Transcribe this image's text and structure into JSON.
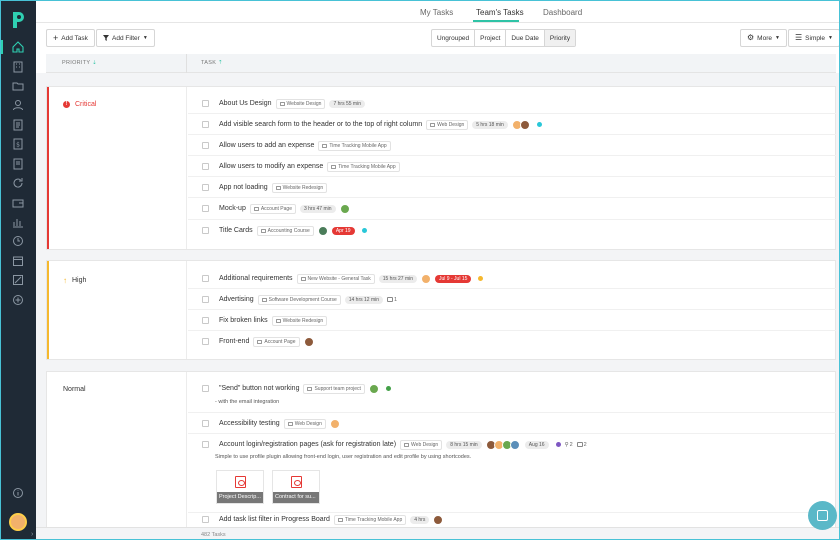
{
  "tabs": {
    "my_tasks": "My Tasks",
    "teams_tasks": "Team's Tasks",
    "dashboard": "Dashboard"
  },
  "toolbar": {
    "add_task": "Add Task",
    "add_filter": "Add Filter",
    "group_by": [
      "Ungrouped",
      "Project",
      "Due Date",
      "Priority"
    ],
    "group_by_active": "Priority",
    "more": "More",
    "view_mode": "Simple"
  },
  "columns": {
    "priority": "PRIORITY",
    "task": "TASK"
  },
  "groups": {
    "critical": {
      "label": "Critical",
      "tasks": [
        {
          "name": "About Us Design",
          "project": "Website Design",
          "time": "7 hrs 55 min"
        },
        {
          "name": "Add visible search form to the header or to the top of right column",
          "project": "Web Design",
          "time": "5 hrs 18 min"
        },
        {
          "name": "Allow users to add an expense",
          "project": "Time Tracking Mobile App"
        },
        {
          "name": "Allow users to modify an expense",
          "project": "Time Tracking Mobile App"
        },
        {
          "name": "App not loading",
          "project": "Website Redesign"
        },
        {
          "name": "Mock-up",
          "project": "Account Page",
          "time": "3 hrs 47 min"
        },
        {
          "name": "Title Cards",
          "project": "Accounting Course",
          "due": "Apr 19"
        }
      ]
    },
    "high": {
      "label": "High",
      "tasks": [
        {
          "name": "Additional requirements",
          "project": "New Website - General Task",
          "time": "15 hrs 27 min",
          "due": "Jul 9 - Jul 15"
        },
        {
          "name": "Advertising",
          "project": "Software Development Course",
          "time": "14 hrs 12 min",
          "comments": "1"
        },
        {
          "name": "Fix broken links",
          "project": "Website Redesign"
        },
        {
          "name": "Front-end",
          "project": "Account Page"
        }
      ]
    },
    "normal": {
      "label": "Normal",
      "tasks": [
        {
          "name": "\"Send\" button not working",
          "project": "Support team project",
          "description": "- with the email integration"
        },
        {
          "name": "Accessibility testing",
          "project": "Web Design"
        },
        {
          "name": "Account login/registration pages (ask for registration late)",
          "project": "Web Design",
          "time": "8 hrs 15 min",
          "due": "Aug 16",
          "subtasks": "2",
          "comments": "2",
          "description": "Simple to use profile plugin allowing front-end login, user registration and edit profile by using shortcodes.",
          "attachments": [
            "Project Descrip...",
            "Contract for su..."
          ]
        },
        {
          "name": "Add task list filter in Progress Board",
          "project": "Time Tracking Mobile App",
          "time": "4 hrs"
        }
      ]
    }
  },
  "footer": {
    "count": "482 Tasks"
  },
  "colors": {
    "critical": "#e53935",
    "high": "#f5b82e",
    "accent": "#2fc3a6",
    "sidebar": "#1f2a36"
  }
}
